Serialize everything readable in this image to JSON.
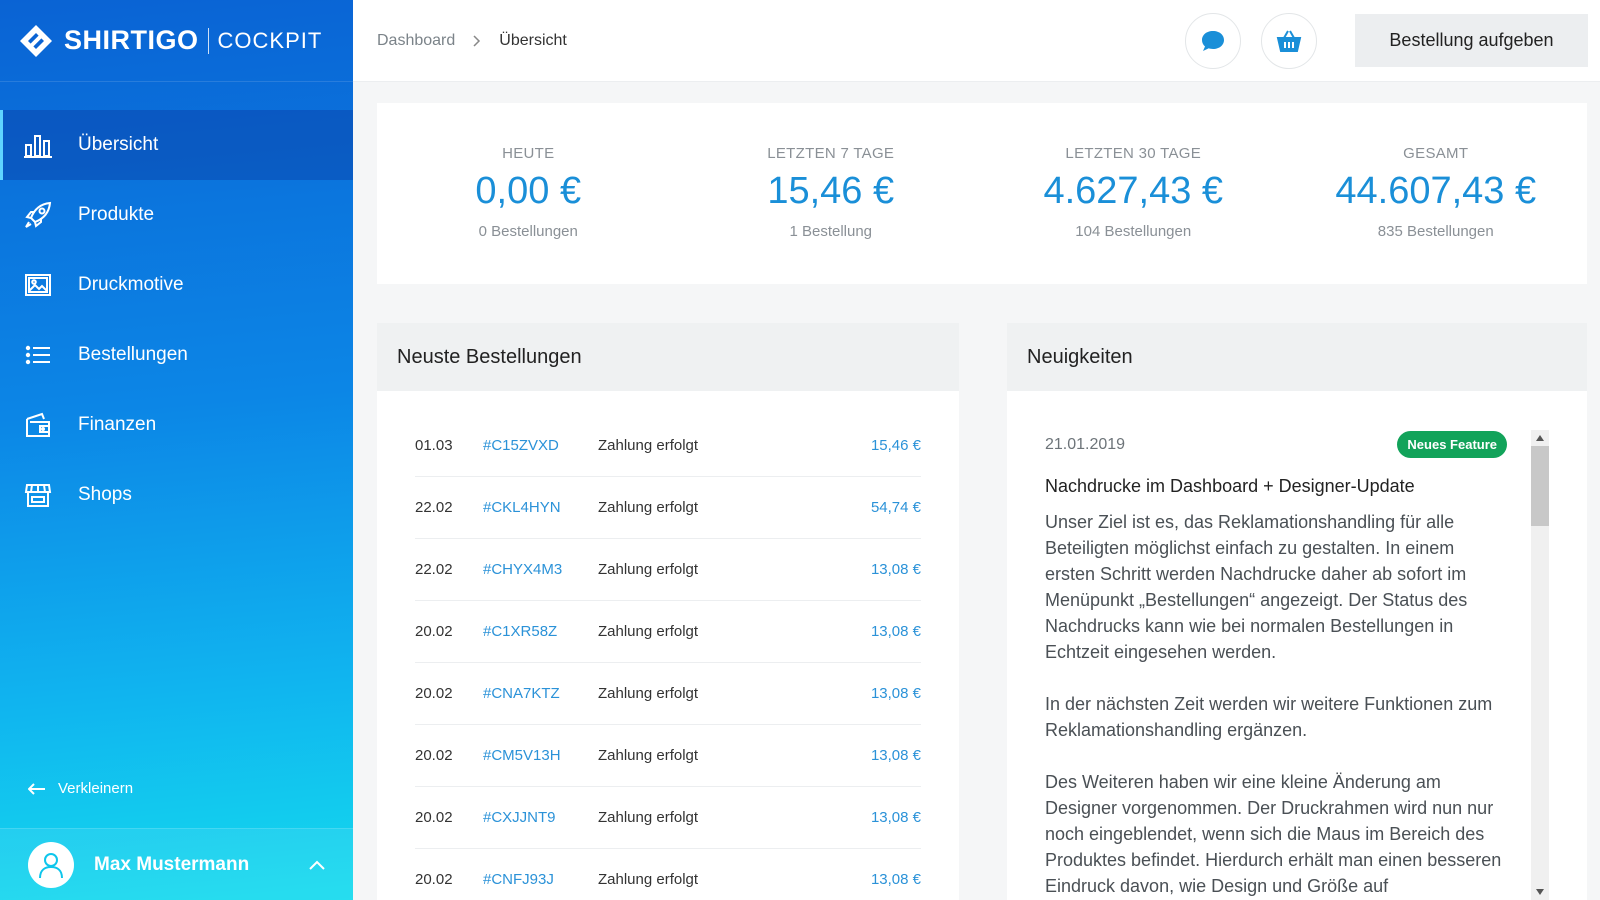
{
  "brand": {
    "name": "SHIRTIGO",
    "sub": "COCKPIT"
  },
  "sidebar": {
    "items": [
      {
        "label": "Übersicht",
        "icon": "bar-chart-icon"
      },
      {
        "label": "Produkte",
        "icon": "rocket-icon"
      },
      {
        "label": "Druckmotive",
        "icon": "image-icon"
      },
      {
        "label": "Bestellungen",
        "icon": "list-icon"
      },
      {
        "label": "Finanzen",
        "icon": "wallet-icon"
      },
      {
        "label": "Shops",
        "icon": "store-icon"
      }
    ],
    "collapse_label": "Verkleinern",
    "user_name": "Max Mustermann"
  },
  "header": {
    "breadcrumb_root": "Dashboard",
    "breadcrumb_current": "Übersicht",
    "order_button": "Bestellung aufgeben"
  },
  "stats": [
    {
      "label": "HEUTE",
      "value": "0,00 €",
      "sub": "0 Bestellungen"
    },
    {
      "label": "LETZTEN 7 TAGE",
      "value": "15,46 €",
      "sub": "1 Bestellung"
    },
    {
      "label": "LETZTEN 30 TAGE",
      "value": "4.627,43 €",
      "sub": "104 Bestellungen"
    },
    {
      "label": "GESAMT",
      "value": "44.607,43 €",
      "sub": "835 Bestellungen"
    }
  ],
  "orders": {
    "title": "Neuste Bestellungen",
    "rows": [
      {
        "date": "01.03",
        "id": "#C15ZVXD",
        "status": "Zahlung erfolgt",
        "amount": "15,46 €"
      },
      {
        "date": "22.02",
        "id": "#CKL4HYN",
        "status": "Zahlung erfolgt",
        "amount": "54,74 €"
      },
      {
        "date": "22.02",
        "id": "#CHYX4M3",
        "status": "Zahlung erfolgt",
        "amount": "13,08 €"
      },
      {
        "date": "20.02",
        "id": "#C1XR58Z",
        "status": "Zahlung erfolgt",
        "amount": "13,08 €"
      },
      {
        "date": "20.02",
        "id": "#CNA7KTZ",
        "status": "Zahlung erfolgt",
        "amount": "13,08 €"
      },
      {
        "date": "20.02",
        "id": "#CM5V13H",
        "status": "Zahlung erfolgt",
        "amount": "13,08 €"
      },
      {
        "date": "20.02",
        "id": "#CXJJNT9",
        "status": "Zahlung erfolgt",
        "amount": "13,08 €"
      },
      {
        "date": "20.02",
        "id": "#CNFJ93J",
        "status": "Zahlung erfolgt",
        "amount": "13,08 €"
      }
    ]
  },
  "news": {
    "title": "Neuigkeiten",
    "date": "21.01.2019",
    "badge": "Neues Feature",
    "headline": "Nachdrucke im Dashboard + Designer-Update",
    "paragraphs": [
      "Unser Ziel ist es, das Reklamationshandling für alle Beteiligten möglichst einfach zu gestalten. In einem ersten Schritt werden Nachdrucke daher ab sofort im Menüpunkt „Bestellungen“ angezeigt. Der Status des Nachdrucks kann wie bei normalen Bestellungen in Echtzeit eingesehen werden.",
      "In der nächsten Zeit werden wir weitere Funktionen zum Reklamationshandling ergänzen.",
      "Des Weiteren haben wir eine kleine Änderung am Designer vorgenommen. Der Druckrahmen wird nun nur noch eingeblendet, wenn sich die Maus im Bereich des Produktes befindet. Hierdurch erhält man einen besseren Eindruck davon, wie Design und Größe auf"
    ]
  },
  "colors": {
    "accent": "#1a8fd8",
    "badge": "#12a35a",
    "sidebar_top": "#0a63d4",
    "sidebar_bottom": "#14dbee"
  }
}
